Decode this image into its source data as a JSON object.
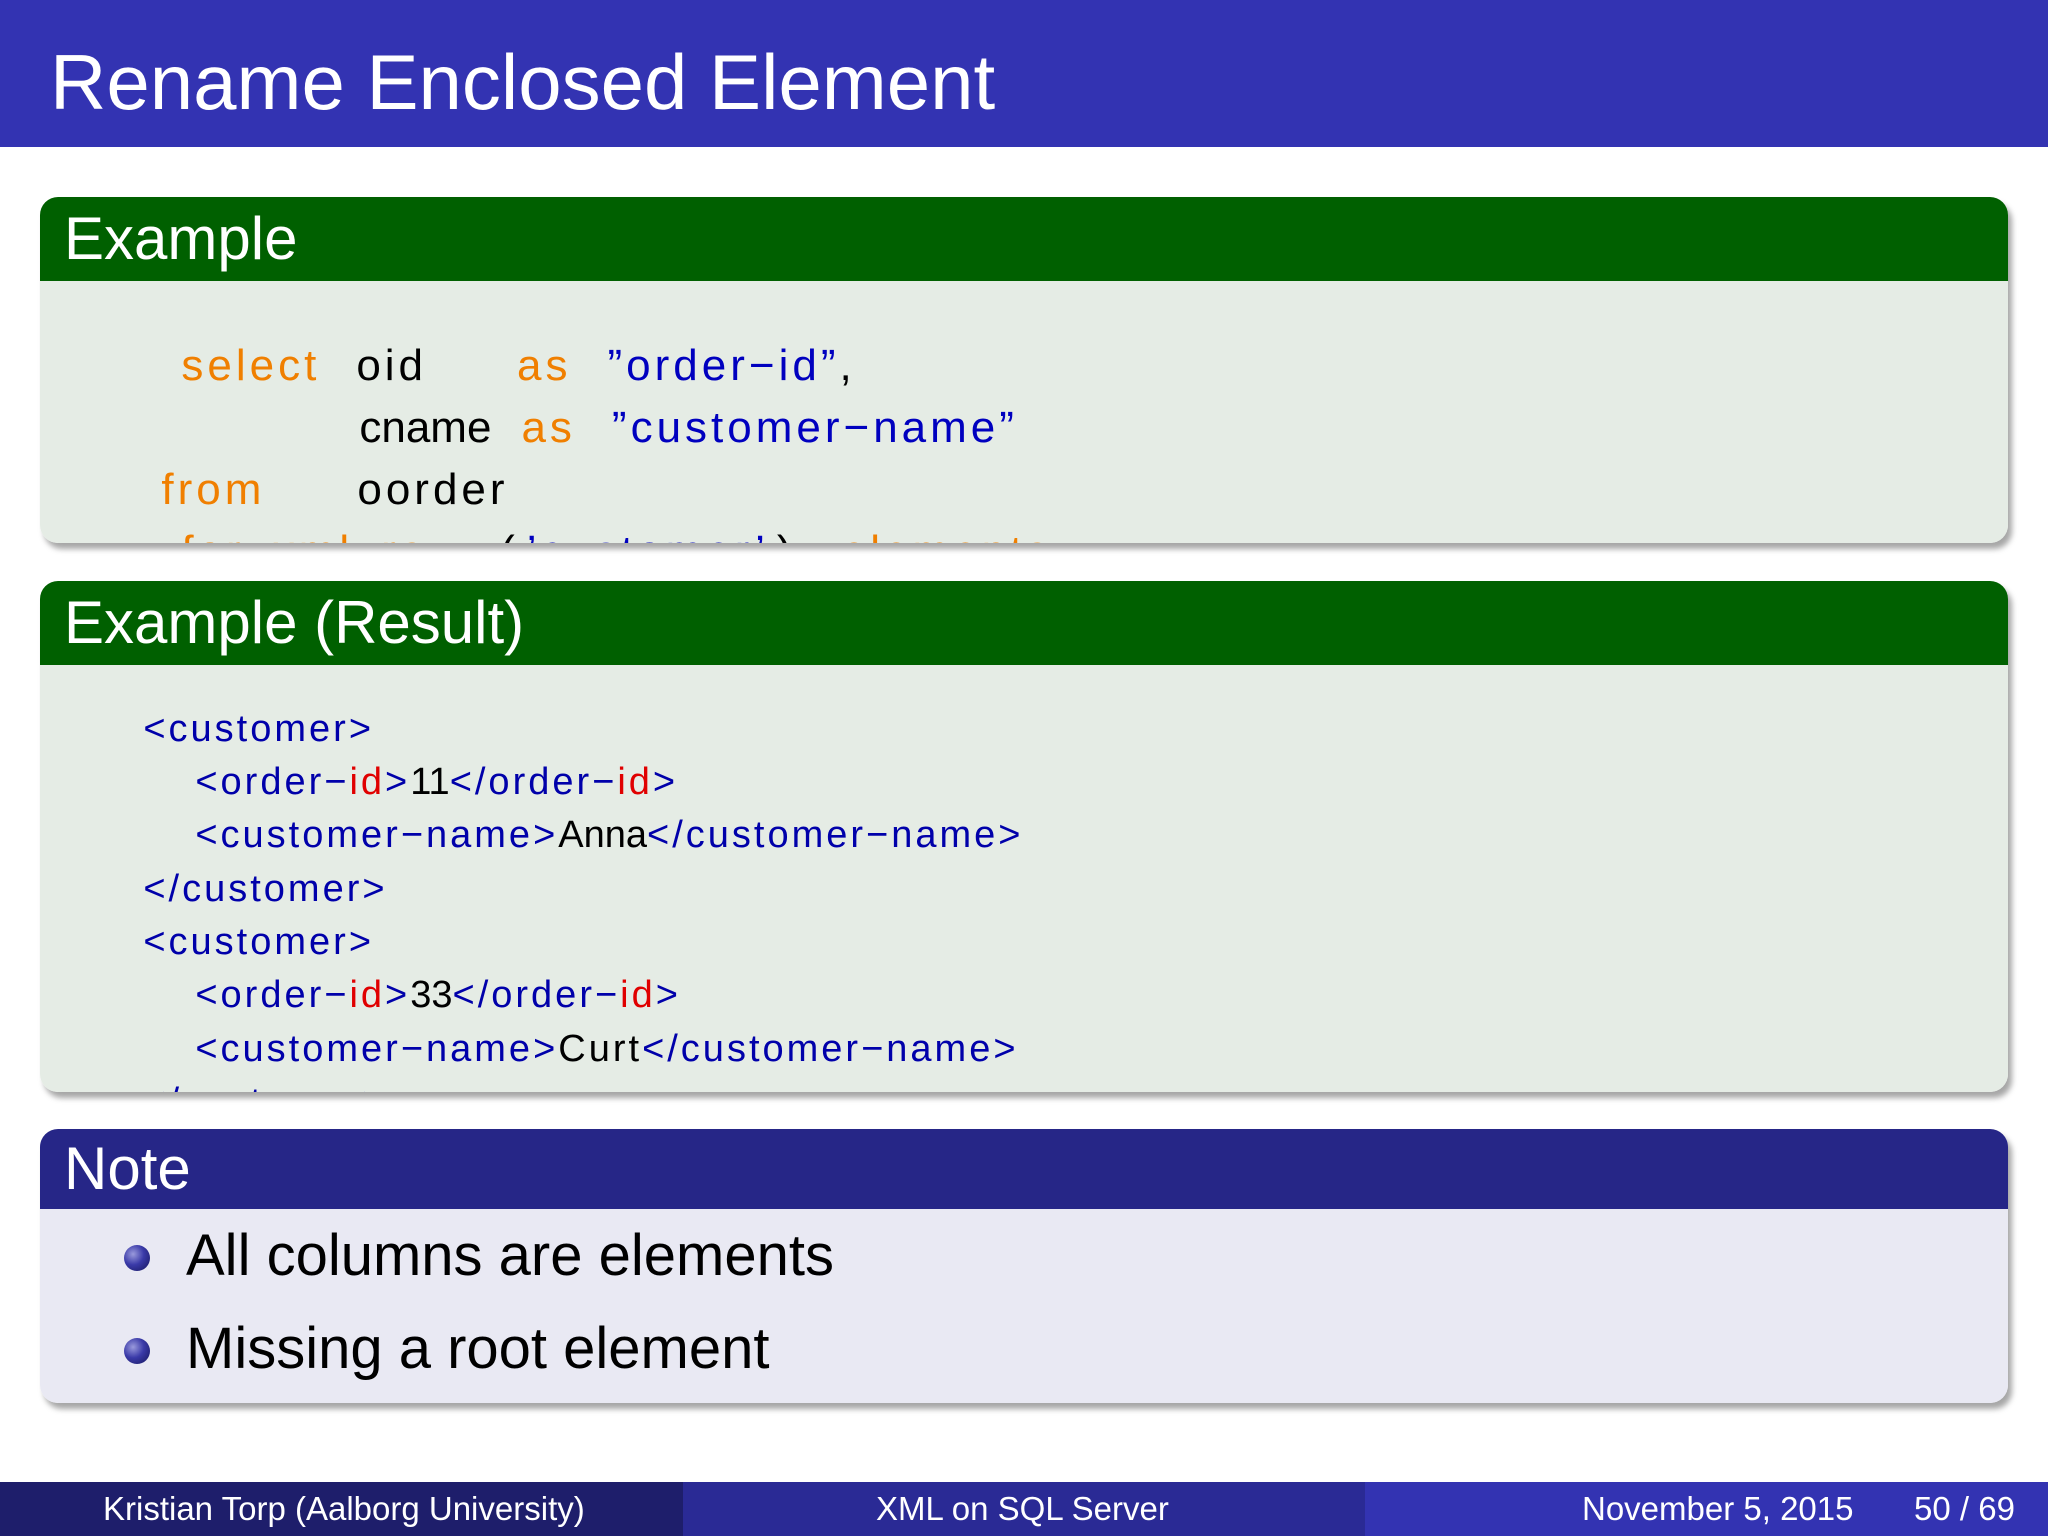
{
  "slide": {
    "title": "Rename Enclosed Element"
  },
  "example": {
    "title": "Example",
    "line1": {
      "kw1": "select",
      "t1": "oid",
      "kw2": "as",
      "s1": "”order−id”",
      "p1": ","
    },
    "line2": {
      "t1": "cname",
      "kw1": "as",
      "s1": "”customer−name”"
    },
    "line3": {
      "kw1": "from",
      "t1": "oorder"
    },
    "line4": {
      "kw1": "for",
      "kw2": "xml",
      "kw3": "raw",
      "p1": "(",
      "s1": "’customer’",
      "p2": "),",
      "kw4": "elements"
    }
  },
  "result": {
    "title": "Example (Result)",
    "lines": [
      {
        "a": "<customer>"
      },
      {
        "a": "<order−",
        "r": "id",
        "b": ">",
        "v": "11",
        "c": "</order−",
        "r2": "id",
        "d": ">"
      },
      {
        "a": "<customer−name>",
        "v": "Anna",
        "c": "</customer−name>"
      },
      {
        "a": "</customer>"
      },
      {
        "a": "<customer>"
      },
      {
        "a": "<order−",
        "r": "id",
        "b": ">",
        "v": "33",
        "c": "</order−",
        "r2": "id",
        "d": ">"
      },
      {
        "a": "<customer−name>",
        "v": "Curt",
        "c": "</customer−name>"
      },
      {
        "a": "</customer>"
      }
    ]
  },
  "note": {
    "title": "Note",
    "items": [
      "All columns are elements",
      "Missing a root element"
    ]
  },
  "footer": {
    "author": "Kristian Torp  (Aalborg University)",
    "talk": "XML on SQL Server",
    "date": "November 5, 2015",
    "page": "50 / 69"
  },
  "colors": {
    "header": "#3333b2",
    "example_title": "#006000",
    "note_title": "#262687",
    "keyword": "#f07f00",
    "string": "#0000bf",
    "highlight": "#e00000"
  }
}
